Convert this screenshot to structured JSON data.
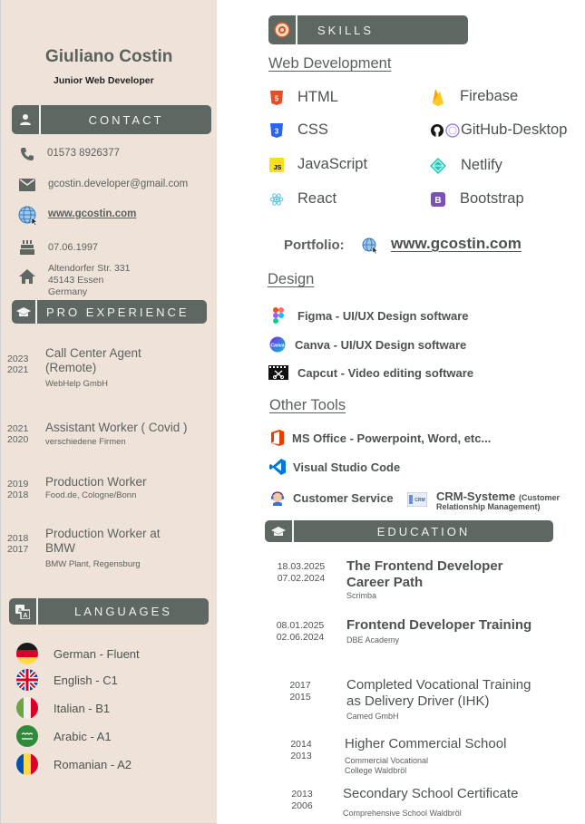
{
  "profile": {
    "name": "Giuliano Costin",
    "title": "Junior Web Developer"
  },
  "contact": {
    "header": "CONTACT",
    "phone": "01573 8926377",
    "email": "gcostin.developer@gmail.com",
    "website": "www.gcostin.com",
    "birthdate": "07.06.1997",
    "address_line1": "Altendorfer Str. 331",
    "address_line2": "45143 Essen",
    "address_line3": "Germany"
  },
  "experience": {
    "header": "PRO EXPERIENCE",
    "items": [
      {
        "year_end": "2023",
        "year_start": "2021",
        "title_line1": "Call Center Agent",
        "title_line2": "(Remote)",
        "org": "WebHelp GmbH"
      },
      {
        "year_end": "2021",
        "year_start": "2020",
        "title_line1": "Assistant Worker ( Covid )",
        "title_line2": "",
        "org": "verschiedene Firmen"
      },
      {
        "year_end": "2019",
        "year_start": "2018",
        "title_line1": "Production Worker",
        "title_line2": "",
        "org": "Food.de, Cologne/Bonn"
      },
      {
        "year_end": "2018",
        "year_start": "2017",
        "title_line1": "Production Worker at",
        "title_line2": "BMW",
        "org": "BMW Plant, Regensburg"
      }
    ]
  },
  "languages": {
    "header": "LANGUAGES",
    "items": [
      {
        "label": "German - Fluent",
        "flag": "de-flag-icon"
      },
      {
        "label": "English - C1",
        "flag": "uk-flag-icon"
      },
      {
        "label": "Italian - B1",
        "flag": "it-flag-icon"
      },
      {
        "label": "Arabic - A1",
        "flag": "sa-flag-icon"
      },
      {
        "label": "Romanian - A2",
        "flag": "ro-flag-icon"
      }
    ]
  },
  "skills": {
    "header": "SKILLS",
    "web_dev_title": "Web Development",
    "web_left": [
      "HTML",
      "CSS",
      "JavaScript",
      "React"
    ],
    "web_right": [
      "Firebase",
      "GitHub-Desktop",
      "Netlify",
      "Bootstrap"
    ],
    "portfolio_label": "Portfolio:",
    "portfolio_link": "www.gcostin.com",
    "design_title": "Design",
    "design_items": [
      "Figma - UI/UX Design software",
      "Canva - UI/UX Design software",
      "Capcut - Video editing software"
    ],
    "other_title": "Other Tools",
    "other_items": [
      "MS Office - Powerpoint, Word, etc...",
      "Visual Studio Code",
      "Customer Service"
    ],
    "crm_label": "CRM-Systeme",
    "crm_note1": "(Customer",
    "crm_note2": "Relationship Management)"
  },
  "education": {
    "header": "EDUCATION",
    "items": [
      {
        "date_end": "18.03.2025",
        "date_start": "07.02.2024",
        "title_line1": "The Frontend Developer",
        "title_line2": "Career Path",
        "org_line1": "Scrimba",
        "org_line2": ""
      },
      {
        "date_end": "08.01.2025",
        "date_start": "02.06.2024",
        "title_line1": "Frontend Developer Training",
        "title_line2": "",
        "org_line1": "DBE Academy",
        "org_line2": ""
      },
      {
        "date_end": "2017",
        "date_start": "2015",
        "title_line1": "Completed Vocational Training",
        "title_line2": "as Delivery Driver (IHK)",
        "org_line1": "Camed GmbH",
        "org_line2": ""
      },
      {
        "date_end": "2014",
        "date_start": "2013",
        "title_line1": "Higher Commercial School",
        "title_line2": "",
        "org_line1": "Commercial Vocational",
        "org_line2": "College Waldbröl"
      },
      {
        "date_end": "2013",
        "date_start": "2006",
        "title_line1": "Secondary School Certificate",
        "title_line2": "",
        "org_line1": "Comprehensive School Waldbröl",
        "org_line2": ""
      }
    ]
  },
  "colors": {
    "sidebar_bg": "#efe3d9",
    "header_bar": "#5e6762",
    "text": "#5b615d"
  }
}
